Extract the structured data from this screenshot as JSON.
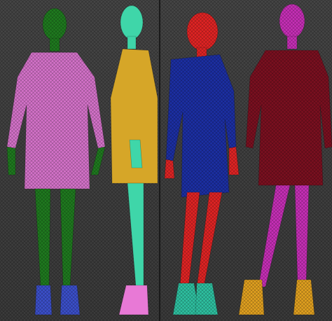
{
  "scene": {
    "viewports": [
      {
        "id": "left",
        "figures": [
          {
            "view": "front",
            "body_color": "#1f7a1f",
            "dress_color": "#d472c9",
            "shoe_color": "#3b4fc9"
          },
          {
            "view": "side",
            "body_color": "#3fd6a9",
            "dress_color": "#d6a628",
            "shoe_color": "#e879d6"
          }
        ]
      },
      {
        "id": "right",
        "figures": [
          {
            "view": "three-quarter",
            "body_color": "#e02424",
            "dress_color": "#1c2fa3",
            "shoe_color": "#2ec0a0"
          },
          {
            "view": "back",
            "body_color": "#c62fb6",
            "dress_color": "#7a1020",
            "shoe_color": "#e0a020"
          }
        ]
      }
    ]
  }
}
